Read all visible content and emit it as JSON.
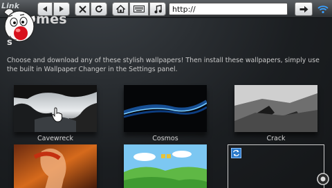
{
  "toolbar": {
    "address_value": "http://",
    "icons": [
      "back-arrow-icon",
      "forward-arrow-icon",
      "stop-icon",
      "refresh-icon",
      "home-icon",
      "keyboard-icon",
      "music-note-icon",
      "go-arrow-icon",
      "wifi-icon"
    ]
  },
  "page": {
    "title_prefix": "Link",
    "title": "mes",
    "section_letter": "s",
    "description_line1": "Choose and download any of these stylish wallpapers! Then install these wallpapers, simply use",
    "description_line2": "the built in Wallpaper Changer in the Settings panel."
  },
  "wallpapers": [
    {
      "name": "Cavewreck"
    },
    {
      "name": "Cosmos"
    },
    {
      "name": "Crack"
    }
  ],
  "colors": {
    "background": "#1b1e21",
    "toolbar": "#3b3f43",
    "wifi_accent": "#3aa0ff",
    "badge_blue": "#2b79c9"
  }
}
